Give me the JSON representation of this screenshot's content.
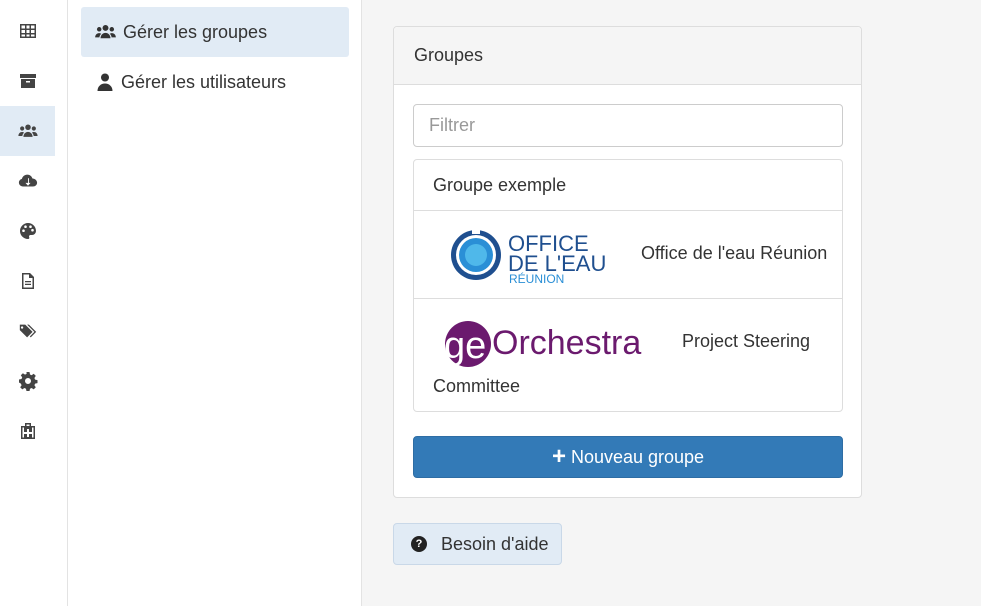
{
  "iconbar": {
    "items": [
      {
        "icon": "table-icon",
        "active": false
      },
      {
        "icon": "archive-icon",
        "active": false
      },
      {
        "icon": "users-icon",
        "active": true
      },
      {
        "icon": "cloud-download-icon",
        "active": false
      },
      {
        "icon": "palette-icon",
        "active": false
      },
      {
        "icon": "document-icon",
        "active": false
      },
      {
        "icon": "tags-icon",
        "active": false
      },
      {
        "icon": "gear-icon",
        "active": false
      },
      {
        "icon": "medkit-icon",
        "active": false
      }
    ]
  },
  "subnav": {
    "groups_label": "Gérer les groupes",
    "users_label": "Gérer les utilisateurs"
  },
  "panel": {
    "title": "Groupes",
    "filter_placeholder": "Filtrer",
    "groups": [
      {
        "label": "Groupe exemple"
      },
      {
        "label": "Office de l'eau Réunion",
        "logo_line1": "OFFICE",
        "logo_line2": "DE L'EAU",
        "logo_line3": "RÉUNION"
      },
      {
        "label_part1": "Project Steering",
        "label_part2": "Committee",
        "logo_a": "ge",
        "logo_b": "Orchestra"
      }
    ],
    "new_group_label": "Nouveau groupe"
  },
  "help": {
    "label": "Besoin d'aide"
  },
  "colors": {
    "primary": "#337ab7",
    "active_bg": "#e1ebf5",
    "office_blue": "#1f4f8f",
    "geo_purple": "#6b1a6e"
  }
}
